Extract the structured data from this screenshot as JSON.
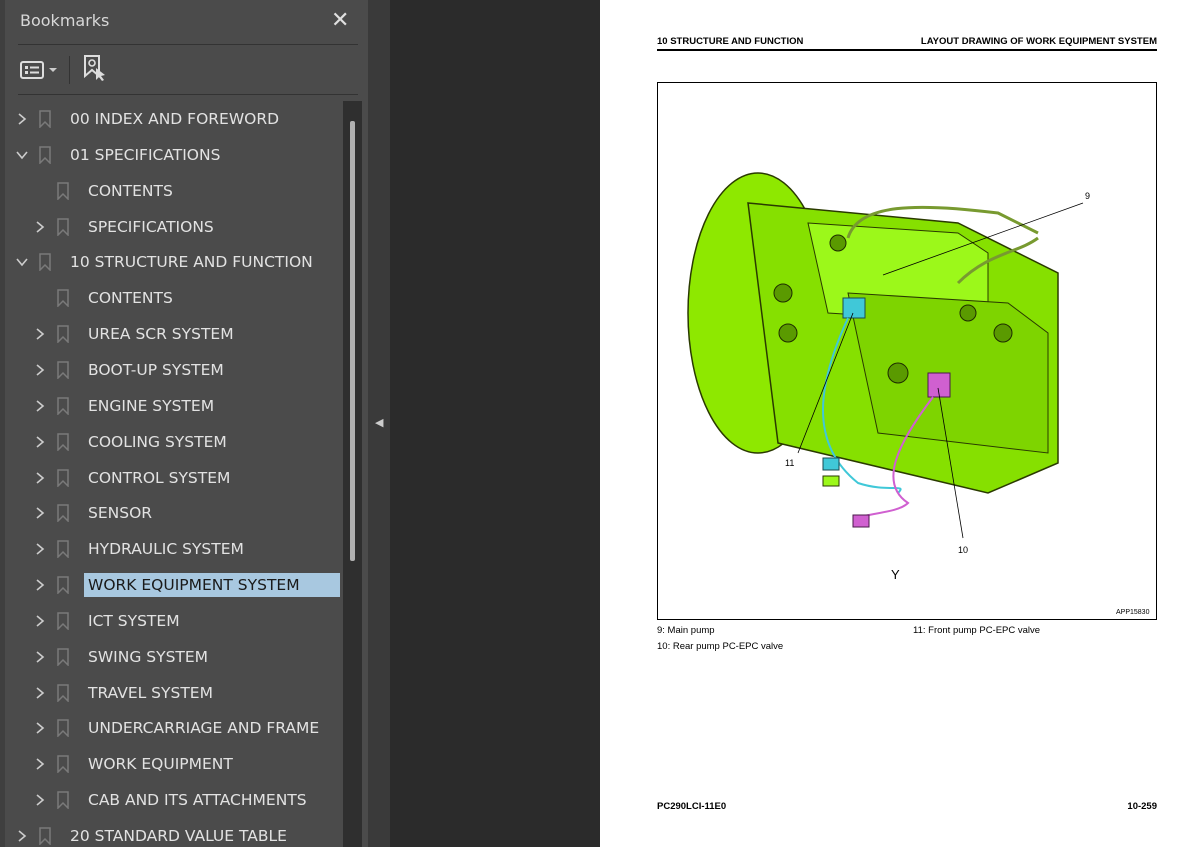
{
  "panel": {
    "title": "Bookmarks",
    "close_icon": "close-icon",
    "toolbar": {
      "options_icon": "list-options-icon",
      "find_icon": "find-bookmark-icon"
    }
  },
  "tree": [
    {
      "label": "00 INDEX AND FOREWORD",
      "level": 0,
      "state": "collapsed"
    },
    {
      "label": "01 SPECIFICATIONS",
      "level": 0,
      "state": "expanded"
    },
    {
      "label": "CONTENTS",
      "level": 1,
      "state": "leaf"
    },
    {
      "label": "SPECIFICATIONS",
      "level": 1,
      "state": "collapsed"
    },
    {
      "label": "10 STRUCTURE AND FUNCTION",
      "level": 0,
      "state": "expanded"
    },
    {
      "label": "CONTENTS",
      "level": 1,
      "state": "leaf"
    },
    {
      "label": "UREA SCR SYSTEM",
      "level": 1,
      "state": "collapsed"
    },
    {
      "label": "BOOT-UP SYSTEM",
      "level": 1,
      "state": "collapsed"
    },
    {
      "label": "ENGINE SYSTEM",
      "level": 1,
      "state": "collapsed"
    },
    {
      "label": "COOLING SYSTEM",
      "level": 1,
      "state": "collapsed"
    },
    {
      "label": "CONTROL SYSTEM",
      "level": 1,
      "state": "collapsed"
    },
    {
      "label": "SENSOR",
      "level": 1,
      "state": "collapsed"
    },
    {
      "label": "HYDRAULIC SYSTEM",
      "level": 1,
      "state": "collapsed"
    },
    {
      "label": "WORK EQUIPMENT SYSTEM",
      "level": 1,
      "state": "collapsed",
      "selected": true
    },
    {
      "label": "ICT SYSTEM",
      "level": 1,
      "state": "collapsed"
    },
    {
      "label": "SWING SYSTEM",
      "level": 1,
      "state": "collapsed"
    },
    {
      "label": "TRAVEL SYSTEM",
      "level": 1,
      "state": "collapsed"
    },
    {
      "label": "UNDERCARRIAGE AND FRAME",
      "level": 1,
      "state": "collapsed"
    },
    {
      "label": "WORK EQUIPMENT",
      "level": 1,
      "state": "collapsed"
    },
    {
      "label": "CAB AND ITS ATTACHMENTS",
      "level": 1,
      "state": "collapsed"
    },
    {
      "label": "20 STANDARD VALUE TABLE",
      "level": 0,
      "state": "collapsed"
    }
  ],
  "page": {
    "header_left": "10 STRUCTURE AND FUNCTION",
    "header_right": "LAYOUT DRAWING OF WORK EQUIPMENT SYSTEM",
    "figure": {
      "callouts": [
        "9",
        "10",
        "11"
      ],
      "view_label": "Y",
      "figure_id": "APP15830"
    },
    "captions": [
      "9: Main pump",
      "11: Front pump PC-EPC valve",
      "10: Rear pump PC-EPC valve"
    ],
    "footer_left": "PC290LCI-11E0",
    "footer_right": "10-259"
  },
  "colors": {
    "selection": "#a8c8e0",
    "pump": "#8cf000",
    "connector_blue": "#40c8d8",
    "connector_pink": "#d060d0"
  }
}
